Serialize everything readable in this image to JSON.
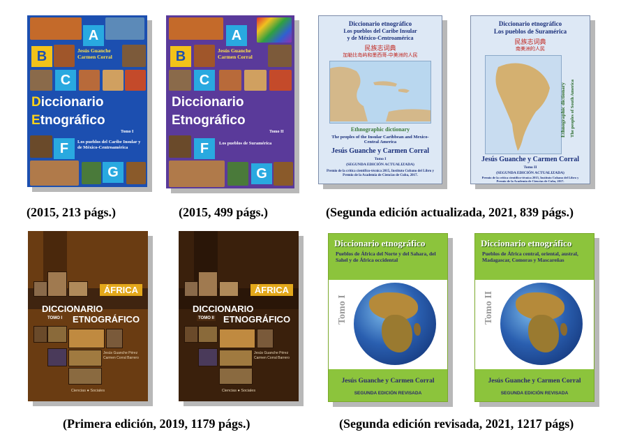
{
  "captions": {
    "c1": "(2015, 213 págs.)",
    "c2": "(2015, 499 págs.)",
    "c3": "(Segunda edición actualizada, 2021, 839 págs.)",
    "c4": "(Primera edición, 2019, 1179 págs.)",
    "c5": "(Segunda edición revisada, 2021, 1217 págs)"
  },
  "book1": {
    "letters": [
      "A",
      "B",
      "C",
      "D",
      "E",
      "F",
      "G"
    ],
    "authors": "Jesús Guanche\nCarmen Corral",
    "title_d": "D",
    "title_rest1": "iccionario",
    "title_e": "E",
    "title_rest2": "tnográfico",
    "tomo": "Tomo I",
    "subtitle": "Los pueblos del Caribe Insular y de México-Centroamérica"
  },
  "book2": {
    "letters": [
      "A",
      "B",
      "C",
      "D",
      "E",
      "F",
      "G"
    ],
    "authors": "Jesús Guanche\nCarmen Corral",
    "title1": "Diccionario",
    "title2": "Etnográfico",
    "tomo": "Tomo II",
    "subtitle": "Los pueblos de Suramérica"
  },
  "book3": {
    "title1": "Diccionario etnográfico",
    "title2": "Los pueblos del Caribe Insular",
    "title3": "y de México-Centroamérica",
    "chinese1": "民族志词典",
    "chinese2": "加勒比岛屿和墨西哥-中美洲的人民",
    "en_title": "Ethnographic dictionary",
    "en_sub": "The peoples of the Insular Caribbean and Mexico-Central America",
    "authors": "Jesús Guanche y Carmen Corral",
    "tomo": "Tomo I",
    "edition": "(SEGUNDA EDICIÓN ACTUALIZADA)",
    "prize": "Premio de la crítica científico-técnica 2015, Instituto Cubano del Libro y Premio de la Academia de Ciencias de Cuba, 2017."
  },
  "book4": {
    "title1": "Diccionario etnográfico",
    "title2": "Los pueblos de Suramérica",
    "chinese1": "民族志词典",
    "chinese2": "南美洲的人民",
    "en_title": "Ethnographic dictionary",
    "en_sub": "The peoples of South America",
    "authors": "Jesús Guanche y Carmen Corral",
    "tomo": "Tomo II",
    "edition": "(SEGUNDA EDICIÓN ACTUALIZADA)",
    "prize": "Premio de la crítica científico-técnica 2015, Instituto Cubano del Libro y Premio de la Academia de Ciencias de Cuba, 2017."
  },
  "book5": {
    "africa": "ÁFRICA",
    "title1": "DICCIONARIO",
    "title2": "ETNOGRÁFICO",
    "tomo": "TOMO I",
    "authors": "Jesús Guanche Pérez\nCarmen Corral Barrero",
    "publisher": "Ciencias ● Sociales"
  },
  "book6": {
    "africa": "ÁFRICA",
    "title1": "DICCIONARIO",
    "title2": "ETNOGRÁFICO",
    "tomo": "TOMO II",
    "authors": "Jesús Guanche Pérez\nCarmen Corral Barrero",
    "publisher": "Ciencias ● Sociales"
  },
  "book7": {
    "title1": "Diccionario etnográfico",
    "title2": "Pueblos de África del Norte y del Sahara, del Sahel y de África occidental",
    "tomo": "Tomo I",
    "authors": "Jesús Guanche y Carmen Corral",
    "edition": "SEGUNDA EDICIÓN REVISADA"
  },
  "book8": {
    "title1": "Diccionario etnográfico",
    "title2": "Pueblos de África central, oriental, austral, Madagascar, Comoras y Mascareñas",
    "tomo": "Tomo II",
    "authors": "Jesús Guanche y Carmen Corral",
    "edition": "SEGUNDA EDICIÓN REVISADA"
  },
  "colors": {
    "blue_cover": "#1c4fb0",
    "purple_cover": "#5a3a9a",
    "letter_box": "#29a9e0",
    "africa_brown": "#6a3c12",
    "africa_gold": "#e3a81b",
    "green_band": "#8cc43c"
  }
}
